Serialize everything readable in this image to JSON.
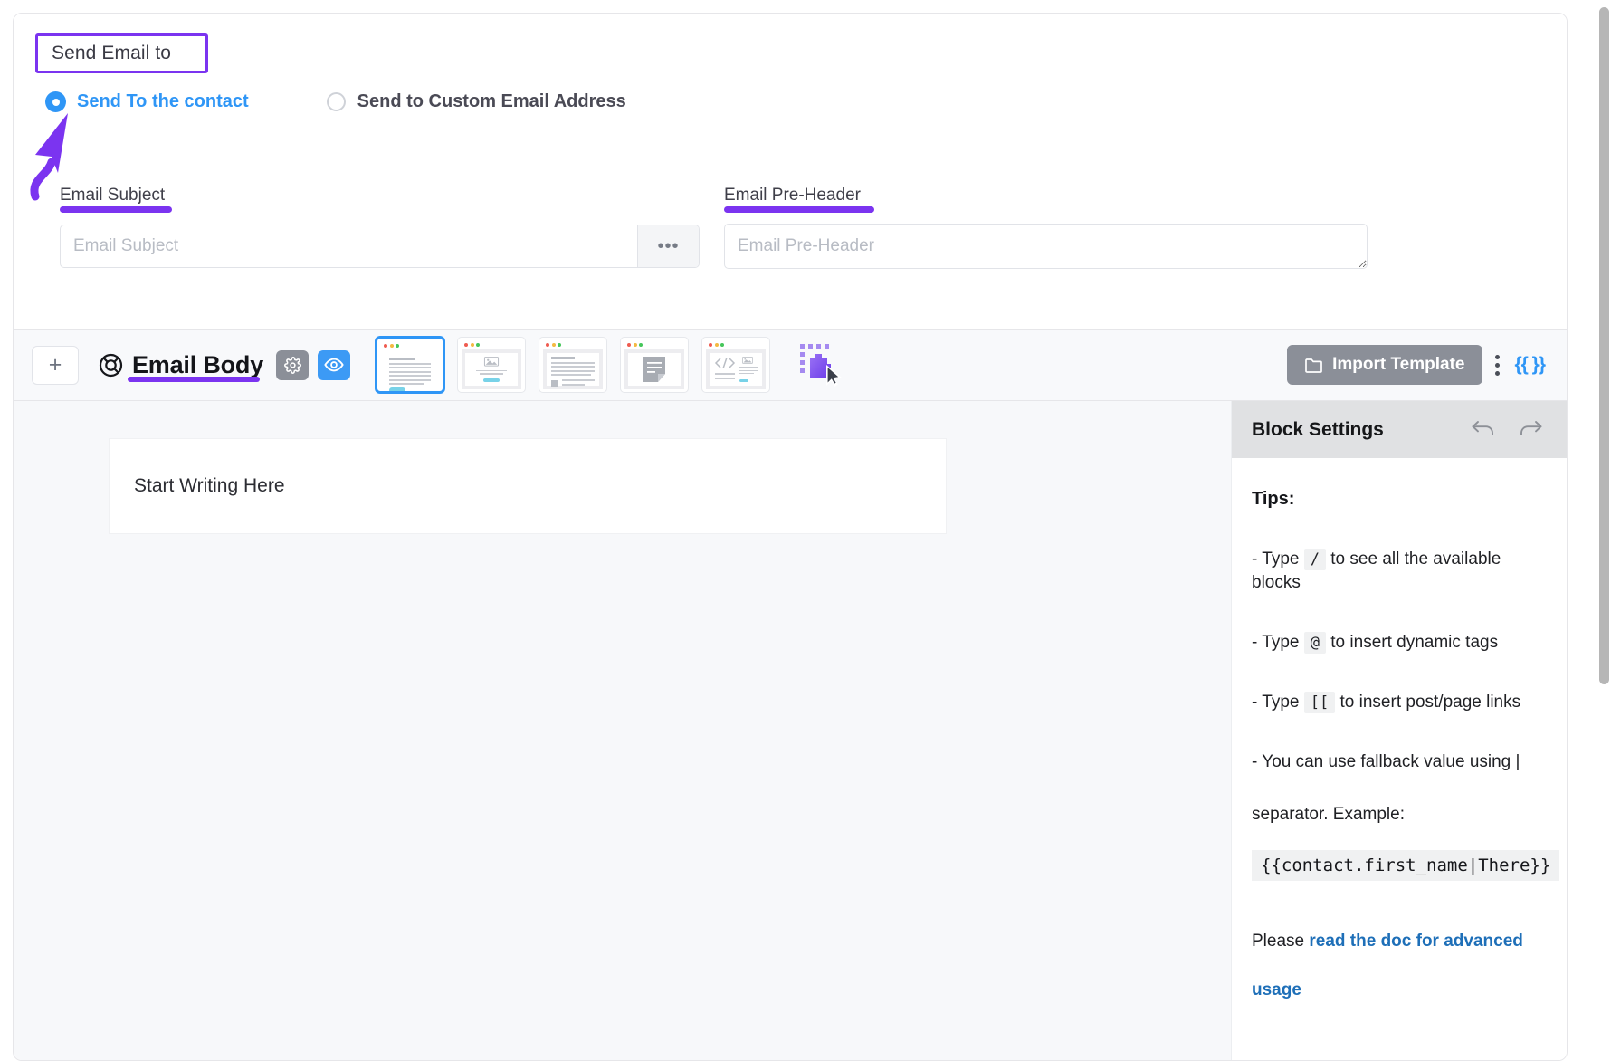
{
  "send_email_to": {
    "section_label": "Send Email to",
    "options": [
      {
        "label": "Send To the contact",
        "selected": true
      },
      {
        "label": "Send to Custom Email Address",
        "selected": false
      }
    ]
  },
  "subject": {
    "label": "Email Subject",
    "value": "",
    "placeholder": "Email Subject",
    "more_label": "•••"
  },
  "preheader": {
    "label": "Email Pre-Header",
    "value": "",
    "placeholder": "Email Pre-Header"
  },
  "toolbar": {
    "add_label": "+",
    "title": "Email Body",
    "settings_icon": "gear-icon",
    "preview_icon": "eye-icon",
    "templates": [
      {
        "name": "text-block-template",
        "selected": true
      },
      {
        "name": "image-block-template",
        "selected": false
      },
      {
        "name": "article-block-template",
        "selected": false
      },
      {
        "name": "note-block-template",
        "selected": false
      },
      {
        "name": "code-image-block-template",
        "selected": false
      }
    ],
    "drag_icon": "drag-block-icon",
    "import_label": "Import Template",
    "kebab_icon": "kebab-menu-icon",
    "merge_tags_label": "{{ }}"
  },
  "canvas": {
    "placeholder": "Start Writing Here"
  },
  "block_settings": {
    "title": "Block Settings",
    "undo_icon": "undo-arrow-icon",
    "redo_icon": "redo-arrow-icon",
    "tips_heading": "Tips:",
    "tips": [
      {
        "prefix": "- Type",
        "key": "/",
        "suffix": "to see all the available blocks"
      },
      {
        "prefix": "- Type",
        "key": "@",
        "suffix": "to insert dynamic tags"
      },
      {
        "prefix": "- Type",
        "key": "[[",
        "suffix": "to insert post/page links"
      }
    ],
    "fallback_line_1": "- You can use fallback value using |",
    "fallback_line_2": "separator. Example:",
    "code_sample": "{{contact.first_name|There}}",
    "doc_prefix": "Please ",
    "doc_link_1": "read the doc for advanced",
    "doc_link_2": "usage"
  },
  "colors": {
    "accent_purple": "#7b34f0",
    "accent_blue": "#2f96f6",
    "gray_button": "#8b8f98",
    "link_blue": "#1e6fb8"
  }
}
